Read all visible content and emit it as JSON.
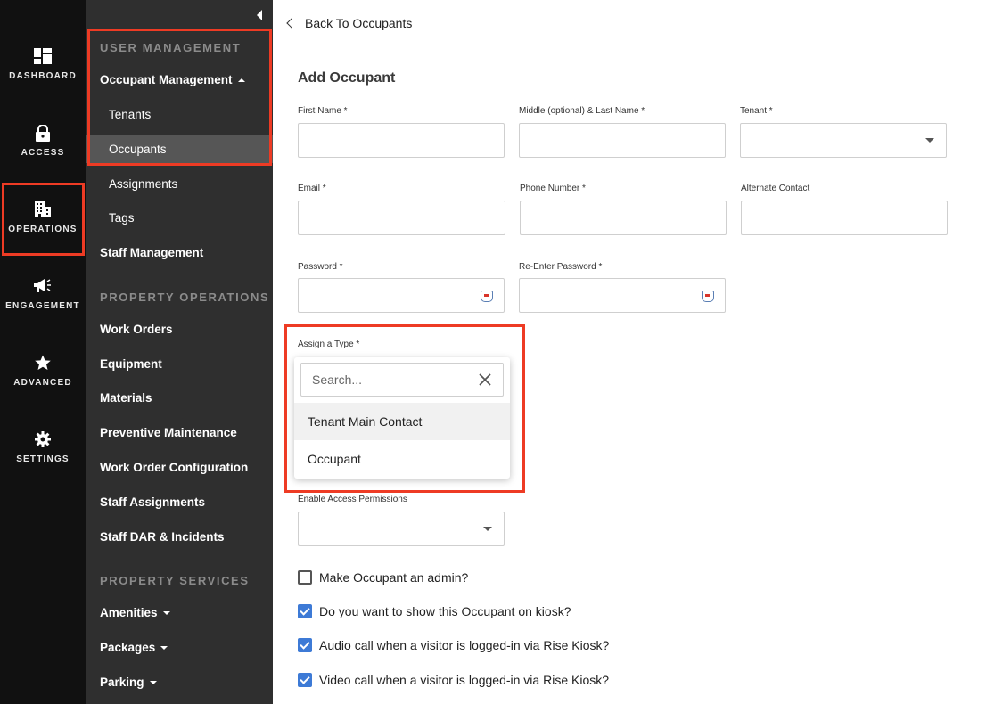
{
  "rail": {
    "items": [
      {
        "label": "DASHBOARD",
        "icon": "dashboard-icon"
      },
      {
        "label": "ACCESS",
        "icon": "lock-icon"
      },
      {
        "label": "OPERATIONS",
        "icon": "building-icon"
      },
      {
        "label": "ENGAGEMENT",
        "icon": "megaphone-icon"
      },
      {
        "label": "ADVANCED",
        "icon": "star-icon"
      },
      {
        "label": "SETTINGS",
        "icon": "gear-icon"
      }
    ],
    "active": "OPERATIONS"
  },
  "sidebar": {
    "user_management_header": "USER MANAGEMENT",
    "occupant_management": "Occupant Management",
    "tenants": "Tenants",
    "occupants": "Occupants",
    "assignments": "Assignments",
    "tags": "Tags",
    "staff_management": "Staff Management",
    "property_operations_header": "PROPERTY OPERATIONS",
    "work_orders": "Work Orders",
    "equipment": "Equipment",
    "materials": "Materials",
    "preventive_maintenance": "Preventive Maintenance",
    "work_order_configuration": "Work Order Configuration",
    "staff_assignments": "Staff Assignments",
    "staff_dar": "Staff DAR & Incidents",
    "property_services_header": "PROPERTY SERVICES",
    "amenities": "Amenities",
    "packages": "Packages",
    "parking": "Parking",
    "active_item": "Occupants"
  },
  "main": {
    "back_link": "Back To Occupants",
    "title": "Add Occupant",
    "fields": {
      "first_name": {
        "label": "First Name *",
        "value": ""
      },
      "last_name": {
        "label": "Middle (optional) & Last Name *",
        "value": ""
      },
      "tenant": {
        "label": "Tenant *",
        "value": ""
      },
      "email": {
        "label": "Email *",
        "value": ""
      },
      "phone": {
        "label": "Phone Number *",
        "value": ""
      },
      "alternate": {
        "label": "Alternate Contact",
        "value": ""
      },
      "password": {
        "label": "Password *",
        "value": ""
      },
      "password2": {
        "label": "Re-Enter Password *",
        "value": ""
      },
      "type": {
        "label": "Assign a Type *"
      },
      "access": {
        "label": "Enable Access Permissions",
        "value": ""
      }
    },
    "type_dropdown": {
      "search_placeholder": "Search...",
      "options": [
        "Tenant Main Contact",
        "Occupant"
      ],
      "highlighted": "Tenant Main Contact"
    },
    "checkboxes": [
      {
        "label": "Make Occupant an admin?",
        "checked": false
      },
      {
        "label": "Do you want to show this Occupant on kiosk?",
        "checked": true
      },
      {
        "label": "Audio call when a visitor is logged-in via Rise Kiosk?",
        "checked": true
      },
      {
        "label": "Video call when a visitor is logged-in via Rise Kiosk?",
        "checked": true
      }
    ]
  },
  "colors": {
    "highlight": "#ee3b24",
    "rail_bg": "#111111",
    "sidebar_bg": "#2f2f2f",
    "checkbox_blue": "#3d7ad6"
  }
}
